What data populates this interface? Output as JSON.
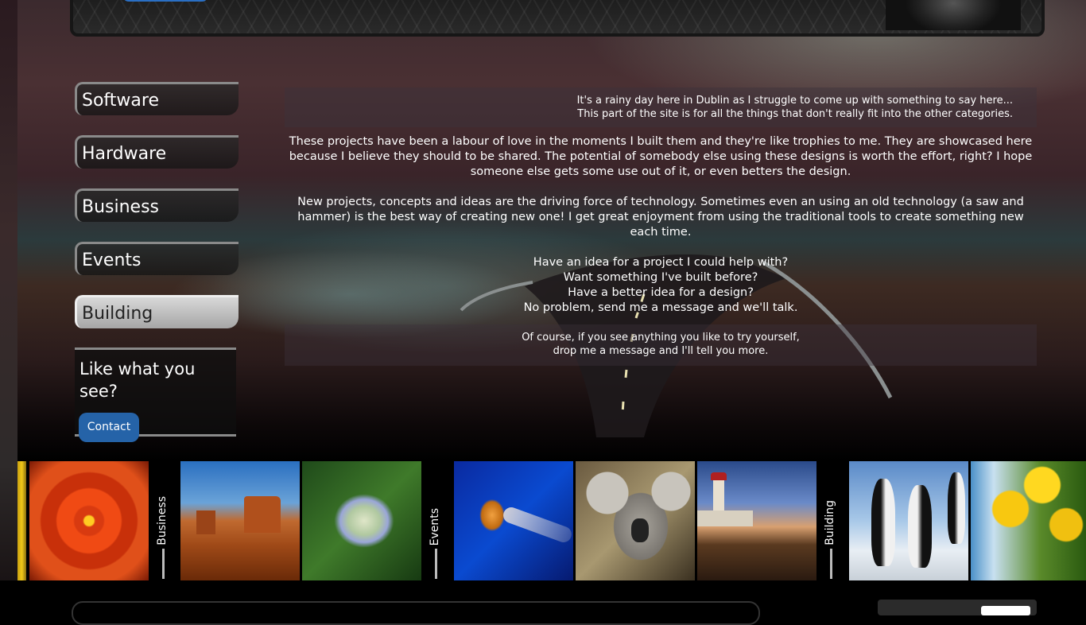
{
  "nav": {
    "items": [
      {
        "label": "Software"
      },
      {
        "label": "Hardware"
      },
      {
        "label": "Business"
      },
      {
        "label": "Events"
      },
      {
        "label": "Building"
      }
    ],
    "active": "Building"
  },
  "cta": {
    "title": "Like what you see?",
    "button": "Contact"
  },
  "intro": {
    "line1": "It's a rainy day here in Dublin as I struggle to come up with something to say here...",
    "line2": "This part of the site is for all the things that don't really fit into the other categories."
  },
  "body": {
    "p1": "These projects have been a labour of love in the moments I built them and they're like trophies to me. They are showcased here because I believe they should to be shared. The potential of somebody else using these designs is worth the effort, right? I hope someone else gets some use out of it, or even betters the design.",
    "p2": "New projects, concepts and ideas are the driving force of technology. Sometimes even an using an old technology (a saw and hammer) is the best way of creating new one! I get great enjoyment from using the traditional tools to create something new each time.",
    "q1": "Have an idea for a project I could help with?",
    "q2": "Want something I've built before?",
    "q3": "Have a better idea for a design?",
    "q4": "No problem, send me a message and we'll talk."
  },
  "outro": {
    "line1": "Of course, if you see anything you like to try yourself,",
    "line2": "drop me a message and I'll tell you more."
  },
  "gallery": {
    "labels": [
      "Business",
      "Events",
      "Building"
    ],
    "tiles": [
      "tulips-photo",
      "chrysanthemum-photo",
      "desert-photo",
      "hydrangeas-photo",
      "jellyfish-photo",
      "koala-photo",
      "lighthouse-photo",
      "penguins-photo",
      "tulips-photo"
    ]
  }
}
